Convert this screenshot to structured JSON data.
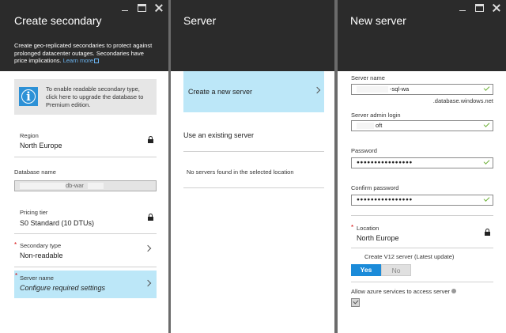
{
  "blade1": {
    "title": "Create secondary",
    "description": "Create geo-replicated secondaries to protect against prolonged datacenter outages. Secondaries have price implications.",
    "learn_more": "Learn more",
    "info": "To enable readable secondary type, click here to upgrade the database to Premium edition.",
    "region": {
      "label": "Region",
      "value": "North Europe"
    },
    "database_name": {
      "label": "Database name",
      "value_suffix": "db-war"
    },
    "pricing_tier": {
      "label": "Pricing tier",
      "value": "S0 Standard (10 DTUs)"
    },
    "secondary_type": {
      "label": "Secondary type",
      "value": "Non-readable"
    },
    "server_name": {
      "label": "Server name",
      "value": "Configure required settings"
    }
  },
  "blade2": {
    "title": "Server",
    "create_new": "Create a new server",
    "use_existing": "Use an existing server",
    "no_servers": "No servers found in the selected location"
  },
  "blade3": {
    "title": "New server",
    "server_name": {
      "label": "Server name",
      "value": "-sql-wa",
      "suffix": ".database.windows.net"
    },
    "admin_login": {
      "label": "Server admin login",
      "value": "oft"
    },
    "password": {
      "label": "Password",
      "value": "●●●●●●●●●●●●●●●●"
    },
    "confirm_password": {
      "label": "Confirm password",
      "value": "●●●●●●●●●●●●●●●●"
    },
    "location": {
      "label": "Location",
      "value": "North Europe"
    },
    "v12": {
      "label": "Create V12 server (Latest update)",
      "yes": "Yes",
      "no": "No"
    },
    "allow_azure": {
      "label": "Allow azure services to access server"
    }
  },
  "colors": {
    "header": "#2b2b2b",
    "selected": "#bce7f8",
    "accent": "#1b8bd9",
    "required": "#d40000",
    "valid": "#6fb23a"
  }
}
